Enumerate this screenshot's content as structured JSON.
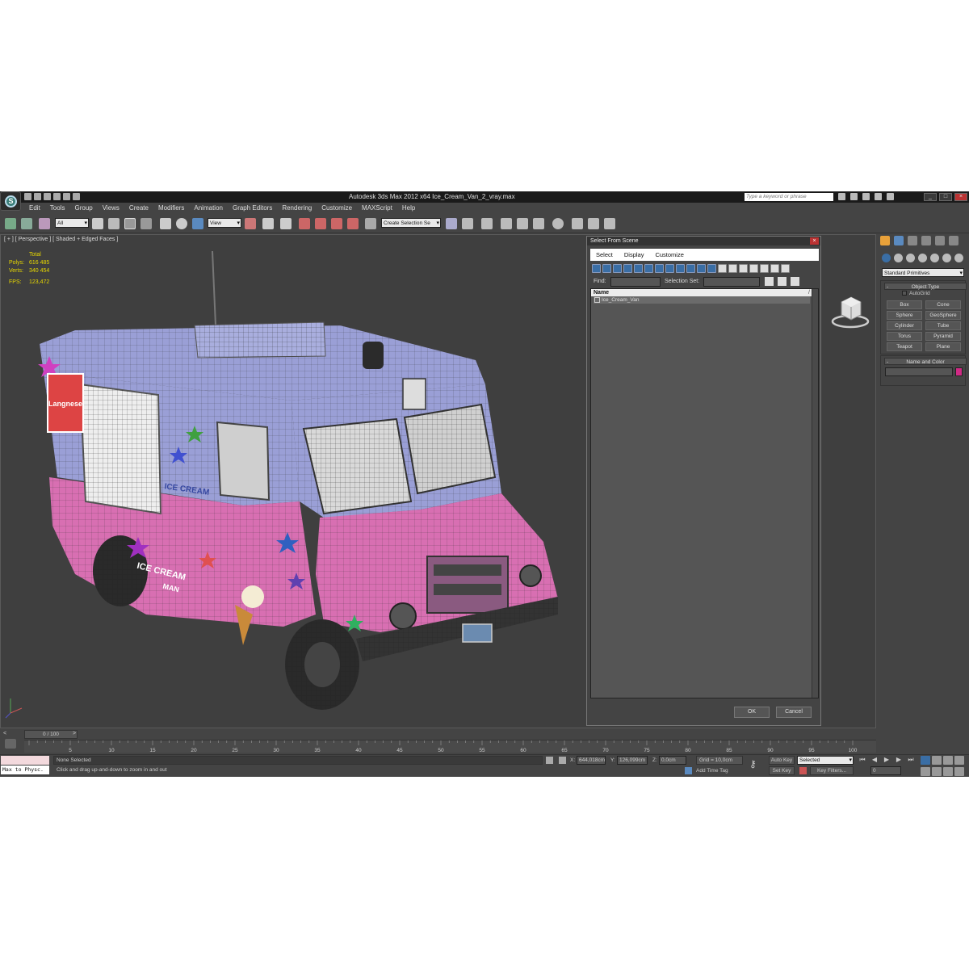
{
  "window": {
    "title": "Autodesk 3ds Max  2012 x64      Ice_Cream_Van_2_vray.max",
    "search_placeholder": "Type a keyword or phrase",
    "controls": [
      "_",
      "□",
      "×"
    ]
  },
  "logo_letter": "S",
  "menu": [
    "Edit",
    "Tools",
    "Group",
    "Views",
    "Create",
    "Modifiers",
    "Animation",
    "Graph Editors",
    "Rendering",
    "Customize",
    "MAXScript",
    "Help"
  ],
  "toolbar": {
    "selection_filter": "All",
    "ref_coord": "View",
    "named_selection": "Create Selection Se"
  },
  "viewport": {
    "label": "[ + ] [ Perspective ] [ Shaded + Edged Faces ]",
    "stats": {
      "total_label": "Total",
      "polys_label": "Polys:",
      "polys_value": "616 485",
      "verts_label": "Verts:",
      "verts_value": "340 454",
      "fps_label": "FPS:",
      "fps_value": "123,472"
    },
    "colors": {
      "stats_text": "#e8d800",
      "van_pink": "#d86fb2",
      "van_lavender": "#9a9fd6",
      "background": "#3f3f3f"
    },
    "decal_text": [
      "ICE CREAM",
      "ICE CREAM",
      "MAN",
      "Langnese"
    ]
  },
  "dialog": {
    "title": "Select From Scene",
    "close": "×",
    "menu": [
      "Select",
      "Display",
      "Customize"
    ],
    "find_label": "Find:",
    "find_value": "",
    "selection_set_label": "Selection Set:",
    "column_name": "Name",
    "items": [
      "Ice_Cream_Van"
    ],
    "ok": "OK",
    "cancel": "Cancel"
  },
  "command_panel": {
    "category": "Standard Primitives",
    "object_type_title": "Object Type",
    "autogrid": "AutoGrid",
    "buttons": [
      "Box",
      "Cone",
      "Sphere",
      "GeoSphere",
      "Cylinder",
      "Tube",
      "Torus",
      "Pyramid",
      "Teapot",
      "Plane"
    ],
    "name_color_title": "Name and Color",
    "object_color": "#d02a85"
  },
  "timeline": {
    "slider": "0 / 100",
    "ticks": [
      "0",
      "5",
      "10",
      "15",
      "20",
      "25",
      "30",
      "35",
      "40",
      "45",
      "50",
      "55",
      "60",
      "65",
      "70",
      "75",
      "80",
      "85",
      "90",
      "95",
      "100"
    ]
  },
  "status": {
    "maxscript_label": "Max to Physc.",
    "selection": "None Selected",
    "hint": "Click and drag up-and-down to zoom in and out",
    "x_label": "X:",
    "x_value": "644,018cm",
    "y_label": "Y:",
    "y_value": "126,099cm",
    "z_label": "Z:",
    "z_value": "0,0cm",
    "grid": "Grid = 10,0cm",
    "add_time_tag": "Add Time Tag",
    "auto_key": "Auto Key",
    "set_key": "Set Key",
    "key_mode": "Selected",
    "key_filters": "Key Filters...",
    "frame": "0"
  }
}
